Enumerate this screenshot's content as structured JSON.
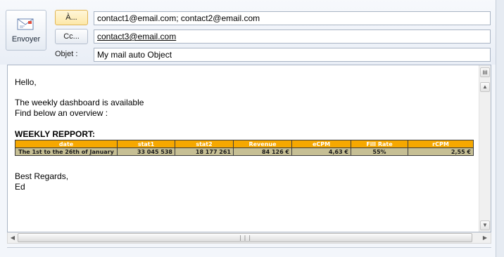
{
  "compose": {
    "send_label": "Envoyer",
    "to_button": "À...",
    "cc_button": "Cc...",
    "subject_label": "Objet :",
    "to_value": "contact1@email.com; contact2@email.com",
    "cc_value": "contact3@email.com",
    "subject_value": "My mail auto Object"
  },
  "body": {
    "greeting": "Hello,",
    "line1": "The weekly dashboard is available",
    "line2": "Find below an overview :",
    "report_title": "WEEKLY REPPORT:",
    "closing": "Best Regards,",
    "signature": "Ed"
  },
  "report": {
    "headers": [
      "date",
      "stat1",
      "stat2",
      "Revenue",
      "eCPM",
      "Fill Rate",
      "rCPM"
    ],
    "row": [
      "The 1st to the 26th of January",
      "33 045 538",
      "18 177 261",
      "84 126 €",
      "4,63 €",
      "55%",
      "2,55 €"
    ],
    "header_color": "#f6a800",
    "row_color": "#c6bf94"
  },
  "icons": {
    "send": "envelope-icon",
    "scroll_up": "arrow-up-icon",
    "scroll_down": "arrow-down-icon",
    "scroll_left": "arrow-left-icon",
    "scroll_right": "arrow-right-icon",
    "pane_toggle": "pane-split-icon"
  }
}
